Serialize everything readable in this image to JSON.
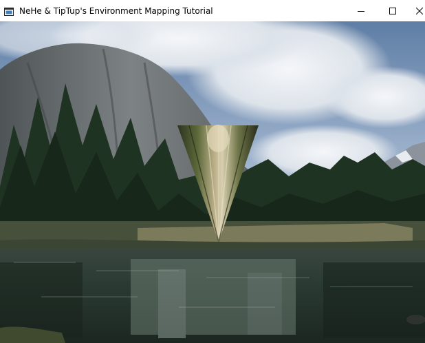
{
  "window": {
    "title": "NeHe & TipTup's Environment Mapping Tutorial",
    "icon": "opengl-app-icon",
    "controls": {
      "minimize": "minimize-icon",
      "maximize": "maximize-icon",
      "close": "close-icon"
    }
  },
  "scene": {
    "background": "mountain-lake-forest-photo",
    "object": "environment-mapped-cone",
    "colors": {
      "sky": "#7f98b8",
      "cloud": "#e4e8ee",
      "cliff": "#6e7275",
      "forest": "#1e3020",
      "water": "#28352f"
    }
  }
}
